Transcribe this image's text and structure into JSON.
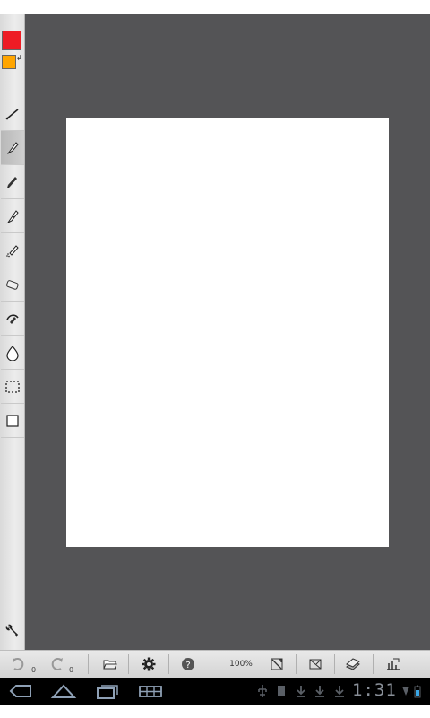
{
  "colors": {
    "primary": "#ee1c24",
    "secondary": "#ffa500",
    "canvas_bg": "#545456",
    "paper": "#ffffff"
  },
  "left_toolbar": {
    "tools": [
      {
        "name": "line-tool",
        "icon": "line-icon"
      },
      {
        "name": "brush-tool",
        "icon": "brush-icon",
        "active": true
      },
      {
        "name": "pencil-tool",
        "icon": "pencil-icon"
      },
      {
        "name": "pen-tool",
        "icon": "pen-icon"
      },
      {
        "name": "airbrush-tool",
        "icon": "airbrush-icon"
      },
      {
        "name": "eraser-tool",
        "icon": "eraser-icon"
      },
      {
        "name": "smudge-tool",
        "icon": "smudge-icon"
      },
      {
        "name": "blur-tool",
        "icon": "drop-icon"
      },
      {
        "name": "selection-tool",
        "icon": "dashed-rect-icon"
      },
      {
        "name": "layer-tool",
        "icon": "rect-icon"
      }
    ],
    "settings_icon": "wrench-icon"
  },
  "bottom_toolbar": {
    "undo_count": "0",
    "redo_count": "0",
    "zoom": "100%"
  },
  "system_bar": {
    "time": "1:31"
  }
}
